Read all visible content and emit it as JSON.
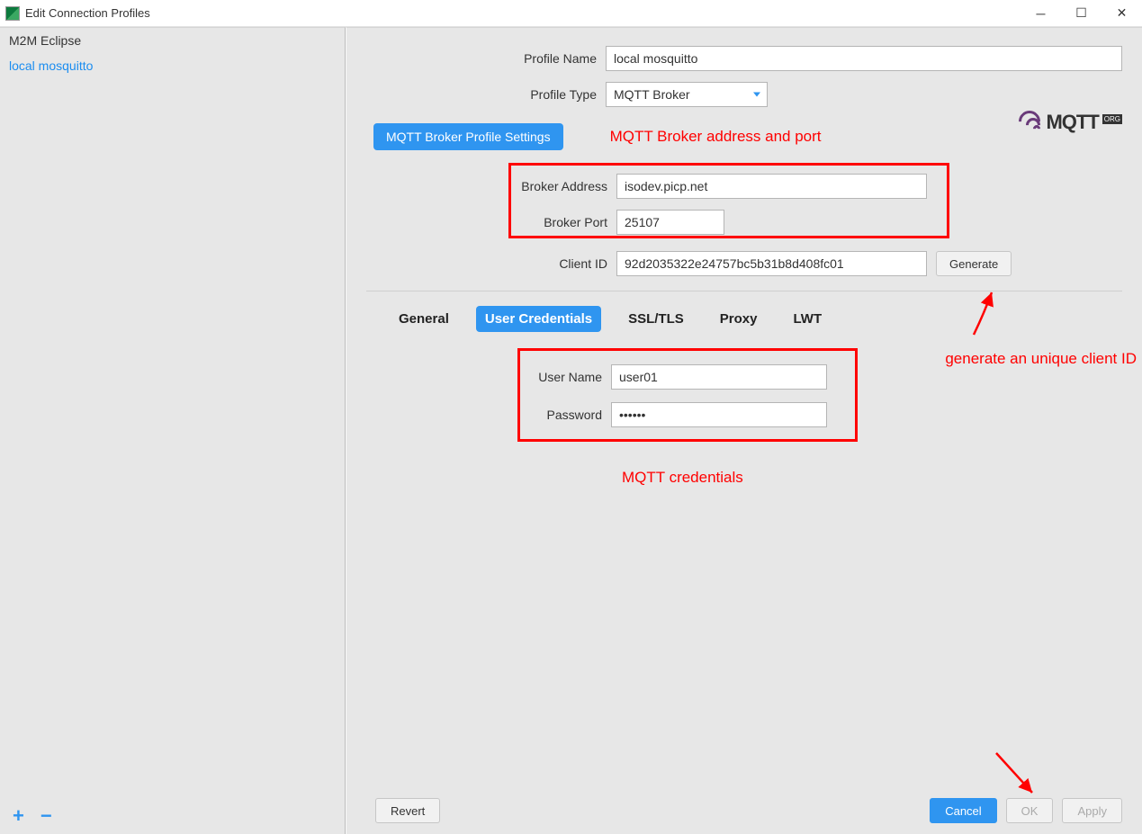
{
  "window": {
    "title": "Edit Connection Profiles"
  },
  "sidebar": {
    "items": [
      {
        "label": "M2M Eclipse"
      },
      {
        "label": "local mosquitto"
      }
    ],
    "add": "+",
    "remove": "−"
  },
  "form": {
    "profile_name_label": "Profile Name",
    "profile_name_value": "local mosquitto",
    "profile_type_label": "Profile Type",
    "profile_type_value": "MQTT Broker",
    "settings_btn": "MQTT Broker Profile Settings",
    "broker_address_label": "Broker Address",
    "broker_address_value": "isodev.picp.net",
    "broker_port_label": "Broker Port",
    "broker_port_value": "25107",
    "client_id_label": "Client ID",
    "client_id_value": "92d2035322e24757bc5b31b8d408fc01",
    "generate_btn": "Generate"
  },
  "tabs": {
    "general": "General",
    "user_credentials": "User Credentials",
    "ssl_tls": "SSL/TLS",
    "proxy": "Proxy",
    "lwt": "LWT"
  },
  "credentials": {
    "username_label": "User Name",
    "username_value": "user01",
    "password_label": "Password",
    "password_value": "••••••"
  },
  "callouts": {
    "broker": "MQTT Broker address and port",
    "generate": "generate an unique client ID",
    "creds": "MQTT credentials"
  },
  "logo": {
    "text": "MQTT",
    "suffix": "ORG"
  },
  "footer": {
    "revert": "Revert",
    "cancel": "Cancel",
    "ok": "OK",
    "apply": "Apply"
  }
}
